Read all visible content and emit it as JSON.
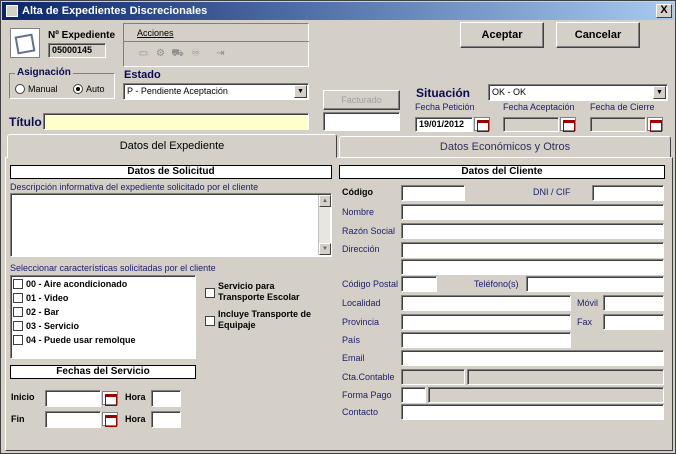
{
  "window": {
    "title": "Alta de Expedientes Discrecionales",
    "close": "X"
  },
  "expediente": {
    "label": "Nº Expediente",
    "value": "05000145"
  },
  "acciones": {
    "label": "Acciones"
  },
  "buttons": {
    "accept": "Aceptar",
    "cancel": "Cancelar",
    "facturado": "Facturado"
  },
  "asignacion": {
    "label": "Asignación",
    "manual": "Manual",
    "auto": "Auto"
  },
  "estado": {
    "label": "Estado",
    "value": "P - Pendiente Aceptación"
  },
  "situacion": {
    "label": "Situación",
    "value": "OK - OK"
  },
  "fechas": {
    "peticion_label": "Fecha Petición",
    "peticion_value": "19/01/2012",
    "aceptacion_label": "Fecha Aceptación",
    "cierre_label": "Fecha de Cierre"
  },
  "titulo": {
    "label": "Título",
    "value": ""
  },
  "tabs": {
    "tab1": "Datos del Expediente",
    "tab2": "Datos Económicos y Otros"
  },
  "solicitud": {
    "header": "Datos de Solicitud",
    "desc_label": "Descripción informativa del expediente solicitado por el cliente",
    "car_label": "Seleccionar características solicitadas por el cliente",
    "items": [
      "00 - Aire acondicionado",
      "01 - Video",
      "02 - Bar",
      "03 - Servicio",
      "04 - Puede usar remolque"
    ],
    "chk_escolar": "Servicio para Transporte Escolar",
    "chk_equipaje": "Incluye Transporte de Equipaje"
  },
  "servicio": {
    "header": "Fechas del Servicio",
    "inicio": "Inicio",
    "fin": "Fin",
    "hora": "Hora"
  },
  "cliente": {
    "header": "Datos del Cliente",
    "codigo": "Código",
    "dni": "DNI / CIF",
    "nombre": "Nombre",
    "razon": "Razón Social",
    "direccion": "Dirección",
    "cp": "Código Postal",
    "telefono": "Teléfono(s)",
    "localidad": "Localidad",
    "movil": "Móvil",
    "provincia": "Provincia",
    "fax": "Fax",
    "pais": "País",
    "email": "Email",
    "cta": "Cta.Contable",
    "forma": "Forma Pago",
    "contacto": "Contacto"
  }
}
